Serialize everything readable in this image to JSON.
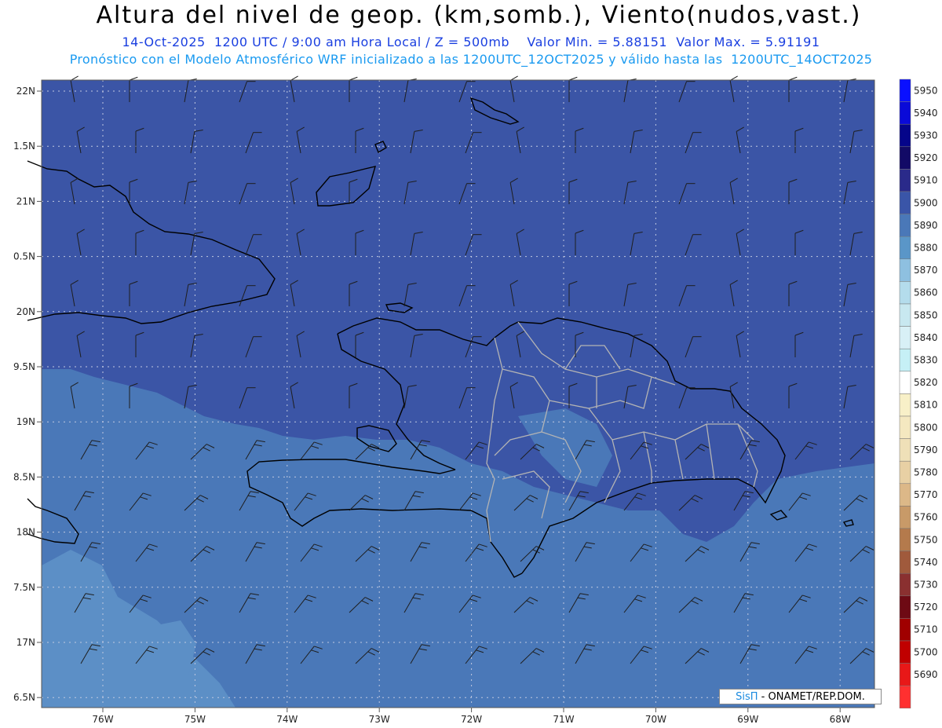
{
  "header": {
    "title": "Altura del nivel de geop. (km,somb.), Viento(nudos,vast.)",
    "subtitle_line1": "14-Oct-2025  1200 UTC / 9:00 am Hora Local / Z = 500mb    Valor Min. = 5.88151  Valor Max. = 5.91191",
    "subtitle_line2": "Pronóstico con el Modelo Atmosférico WRF inicializado a las 1200UTC_12OCT2025 y válido hasta las  1200UTC_14OCT2025"
  },
  "axes": {
    "lat_labels": [
      "22N",
      "1.5N",
      "21N",
      "0.5N",
      "20N",
      "9.5N",
      "19N",
      "8.5N",
      "18N",
      "7.5N",
      "17N",
      "6.5N"
    ],
    "lon_labels": [
      "76W",
      "75W",
      "74W",
      "73W",
      "72W",
      "71W",
      "70W",
      "69W",
      "68W"
    ]
  },
  "colorbar": {
    "levels": [
      {
        "value": "5950",
        "color": "#0a10ff"
      },
      {
        "value": "5940",
        "color": "#0a0ad8"
      },
      {
        "value": "5930",
        "color": "#05058a"
      },
      {
        "value": "5920",
        "color": "#120a66"
      },
      {
        "value": "5910",
        "color": "#2a2a8a"
      },
      {
        "value": "5900",
        "color": "#3a55a8"
      },
      {
        "value": "5890",
        "color": "#4a78b8"
      },
      {
        "value": "5880",
        "color": "#5a96c8"
      },
      {
        "value": "5870",
        "color": "#8ec0e0"
      },
      {
        "value": "5860",
        "color": "#b4dcec"
      },
      {
        "value": "5850",
        "color": "#c8e8f0"
      },
      {
        "value": "5840",
        "color": "#d8f0f6"
      },
      {
        "value": "5830",
        "color": "#c6f0f6"
      },
      {
        "value": "5820",
        "color": "#ffffff"
      },
      {
        "value": "5810",
        "color": "#f8f0c8"
      },
      {
        "value": "5800",
        "color": "#f4e8c0"
      },
      {
        "value": "5790",
        "color": "#efe0b8"
      },
      {
        "value": "5780",
        "color": "#e8d0a4"
      },
      {
        "value": "5770",
        "color": "#dcb888"
      },
      {
        "value": "5760",
        "color": "#c89a68"
      },
      {
        "value": "5750",
        "color": "#b47a4c"
      },
      {
        "value": "5740",
        "color": "#a05a3c"
      },
      {
        "value": "5730",
        "color": "#8a3030"
      },
      {
        "value": "5720",
        "color": "#6e0a14"
      },
      {
        "value": "5710",
        "color": "#a00000"
      },
      {
        "value": "5700",
        "color": "#c00000"
      },
      {
        "value": "5690",
        "color": "#e81818"
      },
      {
        "value": "",
        "color": "#ff3030"
      }
    ]
  },
  "field_colors": {
    "high": "#3b55a6",
    "mid": "#4a78b8",
    "low": "#5c8fc6",
    "coast": "#000000",
    "provinces": "#b4b4b4",
    "barbs": "#1e1e1e",
    "grid": "#c0c8e0"
  },
  "credit": {
    "brand": "SisΠ",
    "text": " - ONAMET/REP.DOM."
  }
}
